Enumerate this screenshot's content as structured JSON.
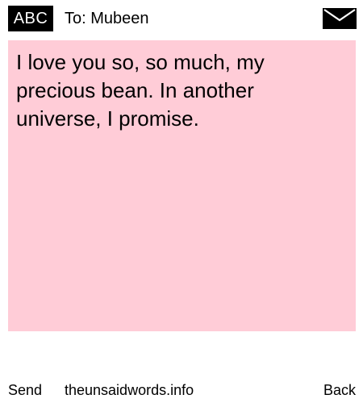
{
  "header": {
    "badge_label": "ABC",
    "recipient": "To: Mubeen",
    "envelope_icon": "envelope-icon"
  },
  "message": {
    "text": "I love you so, so much, my precious bean. In another universe, I promise.",
    "background_color": "#ffccd7"
  },
  "footer": {
    "send_label": "Send",
    "site_label": "theunsaidwords.info",
    "back_label": "Back"
  }
}
